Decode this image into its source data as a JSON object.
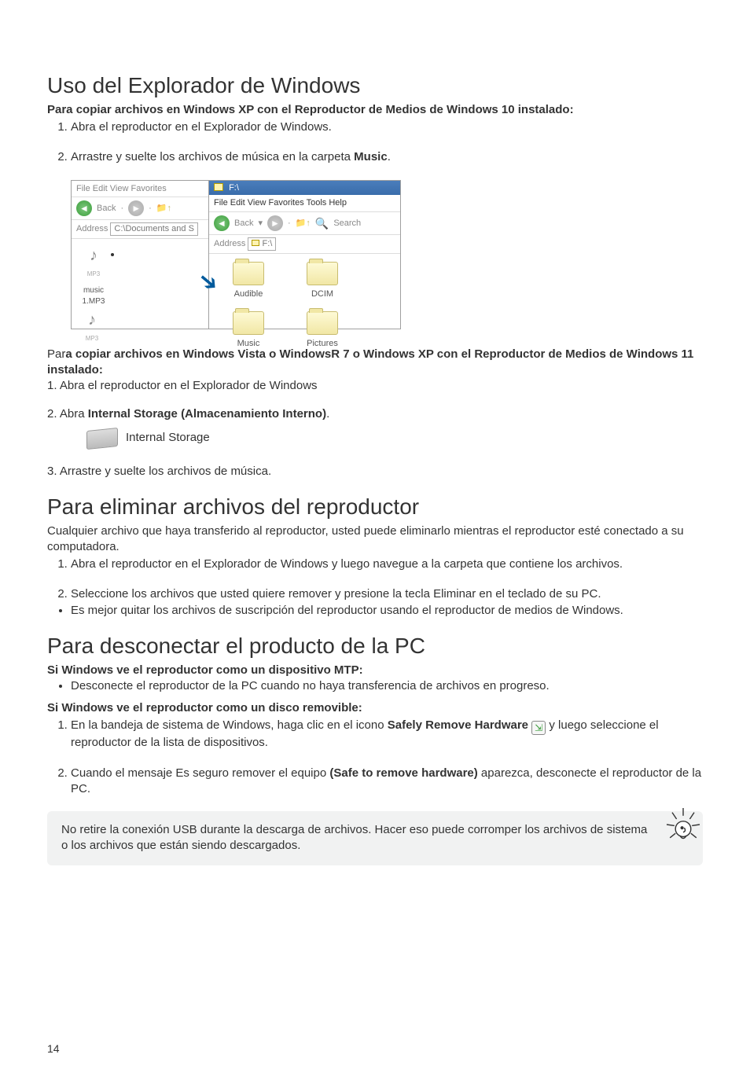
{
  "section1": {
    "heading": "Uso del Explorador de Windows",
    "sub_bold": "Para copiar archivos en Windows XP con el Reproductor de Medios de Windows 10 instalado:",
    "item1": "Abra el reproductor en el Explorador de Windows.",
    "item2_prefix": "Arrastre y suelte los archivos de música en la carpeta ",
    "item2_bold": "Music",
    "item2_suffix": "."
  },
  "explorer": {
    "winA_menu": "File   Edit   View   Favorites",
    "winA_back_label": "Back",
    "winA_addr_label": "Address",
    "winA_addr_value": "C:\\Documents and S",
    "winA_file": "music 1.MP3",
    "winB_title": "F:\\",
    "winB_menu": "File   Edit   View   Favorites   Tools   Help",
    "winB_back_label": "Back",
    "winB_search_label": "Search",
    "winB_addr_label": "Address",
    "winB_addr_value": "F:\\",
    "folders": [
      "Audible",
      "DCIM",
      "Music",
      "Pictures"
    ]
  },
  "section1b": {
    "par_prefix": "Par",
    "par_bold": "a copiar archivos en Windows Vista o WindowsR 7 o Windows XP con el Reproductor de Medios de Windows 11 instalado:",
    "step1": "1. Abra el reproductor en el Explorador de Windows",
    "step2_prefix": "2. Abra ",
    "step2_bold": "Internal Storage (Almacenamiento Interno)",
    "step2_suffix": ".",
    "internal_storage_label": "Internal Storage",
    "step3": "3. Arrastre y suelte los archivos de música."
  },
  "section2": {
    "heading": "Para eliminar archivos del reproductor",
    "intro": "Cualquier archivo que haya transferido al reproductor, usted puede eliminarlo mientras el reproductor esté conectado a su computadora.",
    "item1": "Abra el reproductor en el Explorador de Windows y luego navegue a la carpeta que contiene los archivos.",
    "item2": "Seleccione los archivos que usted quiere remover y presione la tecla Eliminar en el teclado de su PC.",
    "bullet": "Es mejor quitar los archivos de suscripción del reproductor usando el reproductor de medios de Windows."
  },
  "section3": {
    "heading": "Para desconectar el producto de la PC",
    "sub_bold_a": "Si Windows ve el reproductor como un dispositivo MTP:",
    "bullet_a": "Desconecte el reproductor de la PC cuando no haya transferencia de archivos en progreso.",
    "sub_bold_b": "Si Windows ve el reproductor como un disco removible:",
    "item1_prefix": "En la bandeja de sistema de Windows, haga clic en el icono ",
    "item1_bold": "Safely Remove Hardware",
    "item1_suffix": "  y luego seleccione el reproductor de la lista de dispositivos.",
    "item2_prefix": "Cuando el mensaje Es seguro remover el equipo ",
    "item2_bold": "(Safe to remove hardware)",
    "item2_suffix": " aparezca, desconecte el reproductor de la PC.",
    "tips": "No retire la conexión USB durante la descarga de archivos. Hacer eso puede corromper los archivos de sistema o los archivos que están siendo descargados."
  },
  "page_number": "14"
}
